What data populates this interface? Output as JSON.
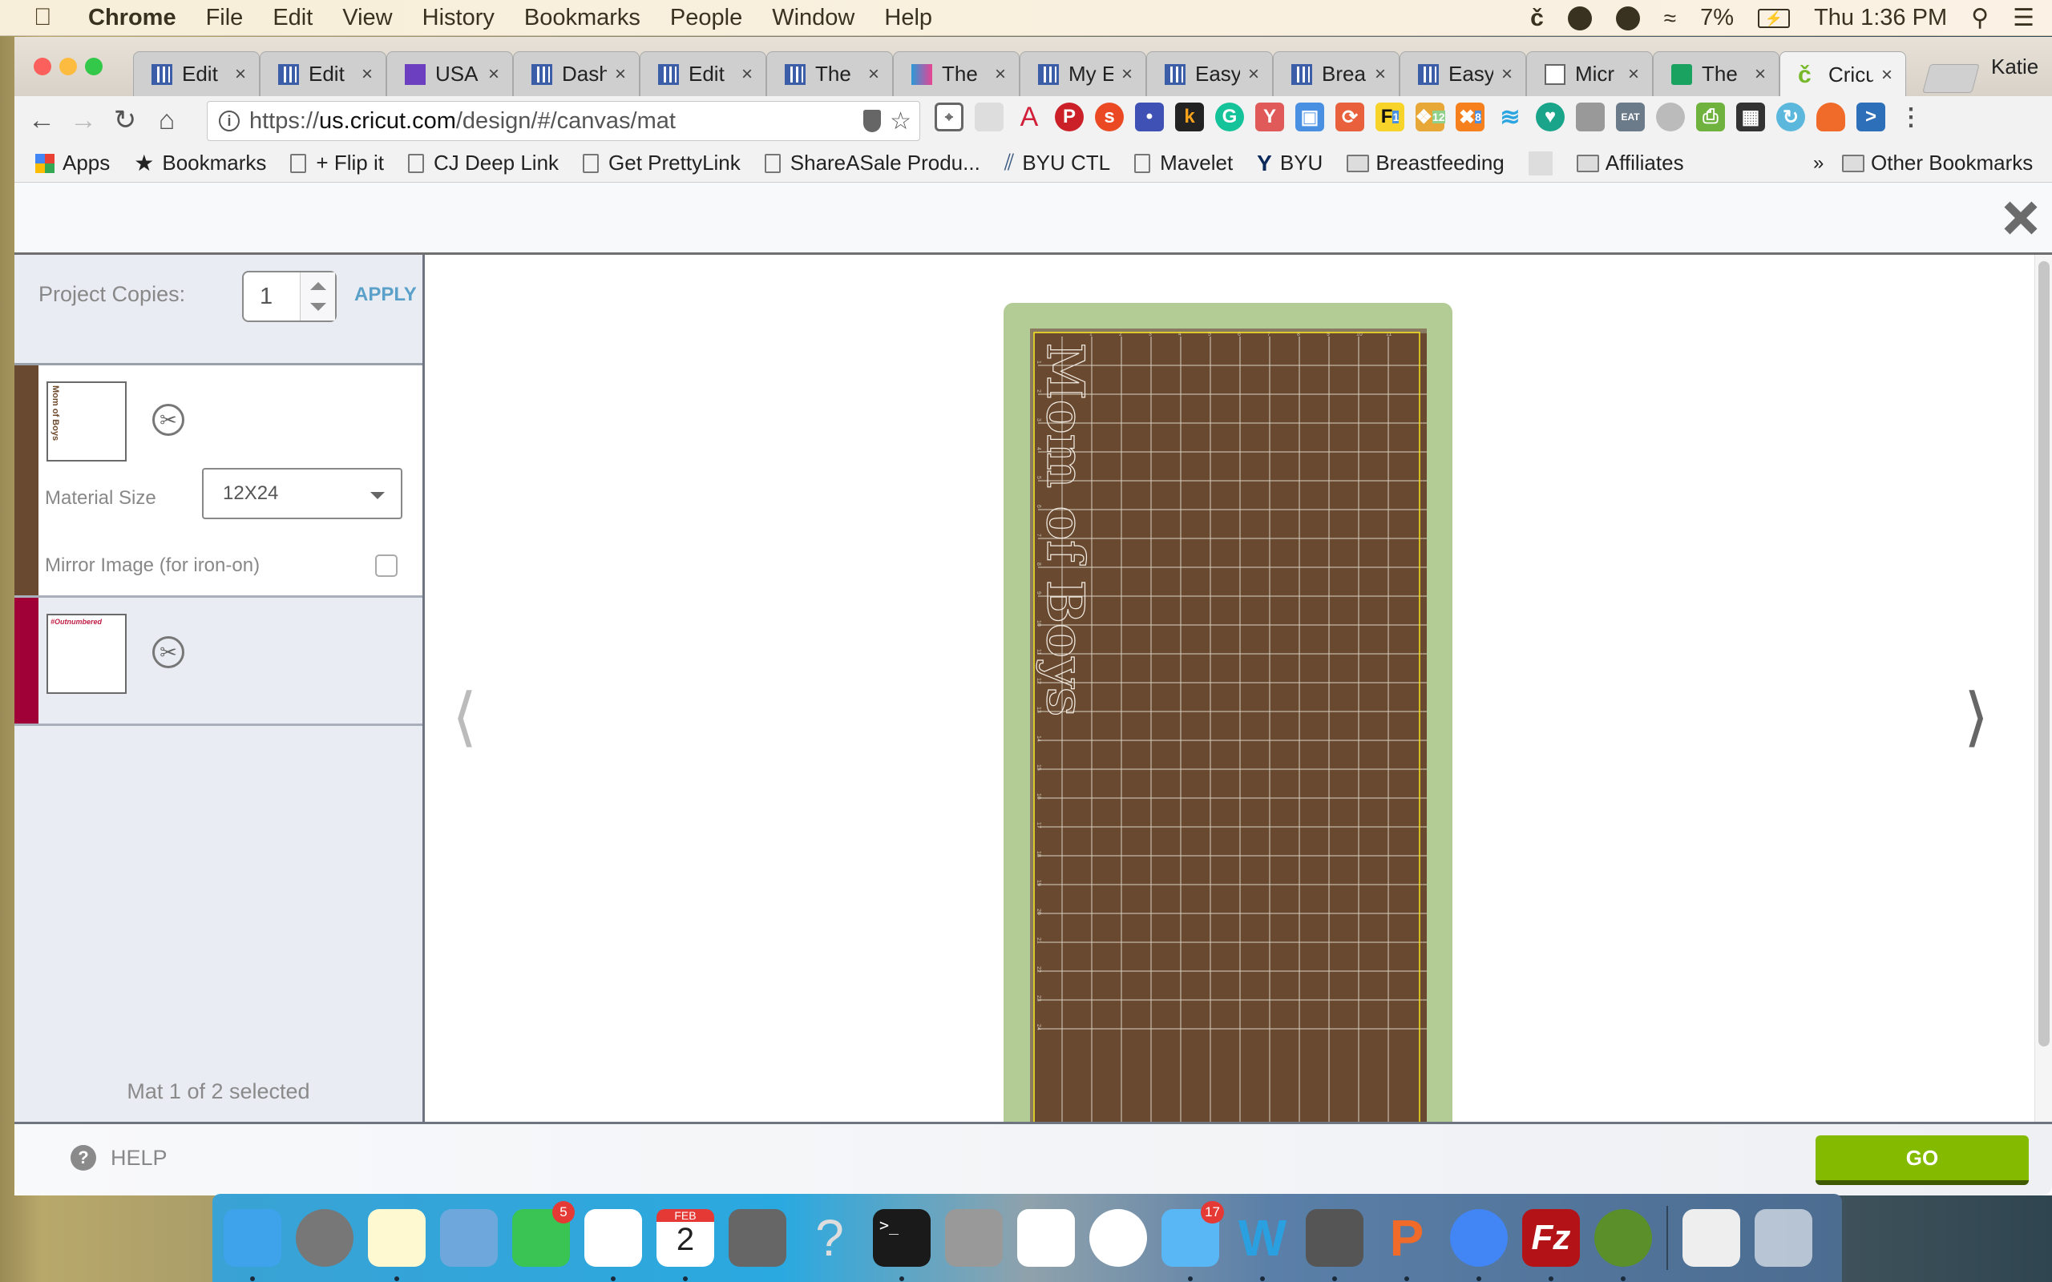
{
  "menubar": {
    "app": "Chrome",
    "items": [
      "File",
      "Edit",
      "View",
      "History",
      "Bookmarks",
      "People",
      "Window",
      "Help"
    ],
    "battery": "7%",
    "clock": "Thu 1:36 PM"
  },
  "browser": {
    "tabs": [
      {
        "label": "Edit",
        "icon": "sheets"
      },
      {
        "label": "Edit",
        "icon": "sheets"
      },
      {
        "label": "USA",
        "icon": "forms"
      },
      {
        "label": "Dash",
        "icon": "sheets"
      },
      {
        "label": "Edit",
        "icon": "sheets"
      },
      {
        "label": "The",
        "icon": "sheets"
      },
      {
        "label": "The",
        "icon": "sail"
      },
      {
        "label": "My E",
        "icon": "sheets"
      },
      {
        "label": "Easy",
        "icon": "sheets"
      },
      {
        "label": "Brea",
        "icon": "sheets"
      },
      {
        "label": "Easy",
        "icon": "sheets"
      },
      {
        "label": "Micr",
        "icon": "doc"
      },
      {
        "label": "The",
        "icon": "hangouts"
      },
      {
        "label": "Cricu",
        "icon": "cricut",
        "active": true
      }
    ],
    "profile": "Katie",
    "url_scheme": "https://",
    "url_host": "us.cricut.com",
    "url_path": "/design/#/canvas/mat",
    "bookmarks": [
      {
        "label": "Apps",
        "icon": "apps"
      },
      {
        "label": "Bookmarks",
        "icon": "star"
      },
      {
        "label": "+ Flip it",
        "icon": "page"
      },
      {
        "label": "CJ Deep Link",
        "icon": "page"
      },
      {
        "label": "Get PrettyLink",
        "icon": "page"
      },
      {
        "label": "ShareASale Produ...",
        "icon": "page"
      },
      {
        "label": "BYU CTL",
        "icon": "byu-ctl"
      },
      {
        "label": "Mavelet",
        "icon": "page"
      },
      {
        "label": "BYU",
        "icon": "byu"
      },
      {
        "label": "Breastfeeding",
        "icon": "folder"
      },
      {
        "label": "",
        "icon": "butterfly"
      },
      {
        "label": "Affiliates",
        "icon": "folder"
      }
    ],
    "bookmarks_overflow": "»",
    "other_bookmarks": "Other Bookmarks",
    "extension_badges": [
      "1",
      "12",
      "8"
    ]
  },
  "sidebar": {
    "project_copies_label": "Project Copies:",
    "project_copies_value": "1",
    "apply_label": "APPLY",
    "mats": [
      {
        "color": "#694a30",
        "thumb_text": "Mom of Boys",
        "selected": true,
        "material_size_label": "Material Size",
        "material_size": "12X24",
        "mirror_label": "Mirror Image (for iron-on)",
        "mirror_checked": false
      },
      {
        "color": "#a00238",
        "thumb_text": "#Outnumbered",
        "selected": false
      }
    ],
    "mat_count": "Mat 1 of 2 selected"
  },
  "canvas": {
    "mat_text": "Mom of Boys",
    "ruler_top": [
      "1",
      "2",
      "3",
      "4",
      "5",
      "6",
      "7",
      "8",
      "9",
      "10",
      "11"
    ],
    "ruler_left": [
      "1",
      "2",
      "3",
      "4",
      "5",
      "6",
      "7",
      "8",
      "9",
      "10",
      "11",
      "12",
      "13",
      "14",
      "15",
      "16",
      "17",
      "18",
      "19",
      "20",
      "21",
      "22",
      "23",
      "24"
    ],
    "mat_color": "#694a30",
    "mat_border_color": "#b3cb94"
  },
  "footer": {
    "help_label": "HELP",
    "go_label": "GO"
  },
  "dock": {
    "apps": [
      {
        "name": "Finder",
        "running": true
      },
      {
        "name": "Launchpad",
        "running": false
      },
      {
        "name": "Notes",
        "running": true
      },
      {
        "name": "Mail",
        "running": false
      },
      {
        "name": "FaceTime",
        "badge": "5",
        "running": false
      },
      {
        "name": "Reminders",
        "running": true
      },
      {
        "name": "Calendar",
        "month": "FEB",
        "day": "2",
        "running": true
      },
      {
        "name": "System Preferences",
        "running": false
      },
      {
        "name": "Unknown",
        "running": false
      },
      {
        "name": "Terminal",
        "running": true
      },
      {
        "name": "Calculator",
        "running": false
      },
      {
        "name": "Google Apps",
        "running": false
      },
      {
        "name": "Photos",
        "running": false
      },
      {
        "name": "Messages",
        "badge": "17",
        "running": true
      },
      {
        "name": "Word",
        "running": true
      },
      {
        "name": "Sublime Text",
        "running": true
      },
      {
        "name": "PowerPoint",
        "running": true
      },
      {
        "name": "Chrome",
        "running": true
      },
      {
        "name": "FileZilla",
        "running": true
      },
      {
        "name": "Time Machine",
        "running": true
      },
      {
        "name": "Chrome Window",
        "running": false
      },
      {
        "name": "Trash",
        "running": false
      }
    ]
  }
}
